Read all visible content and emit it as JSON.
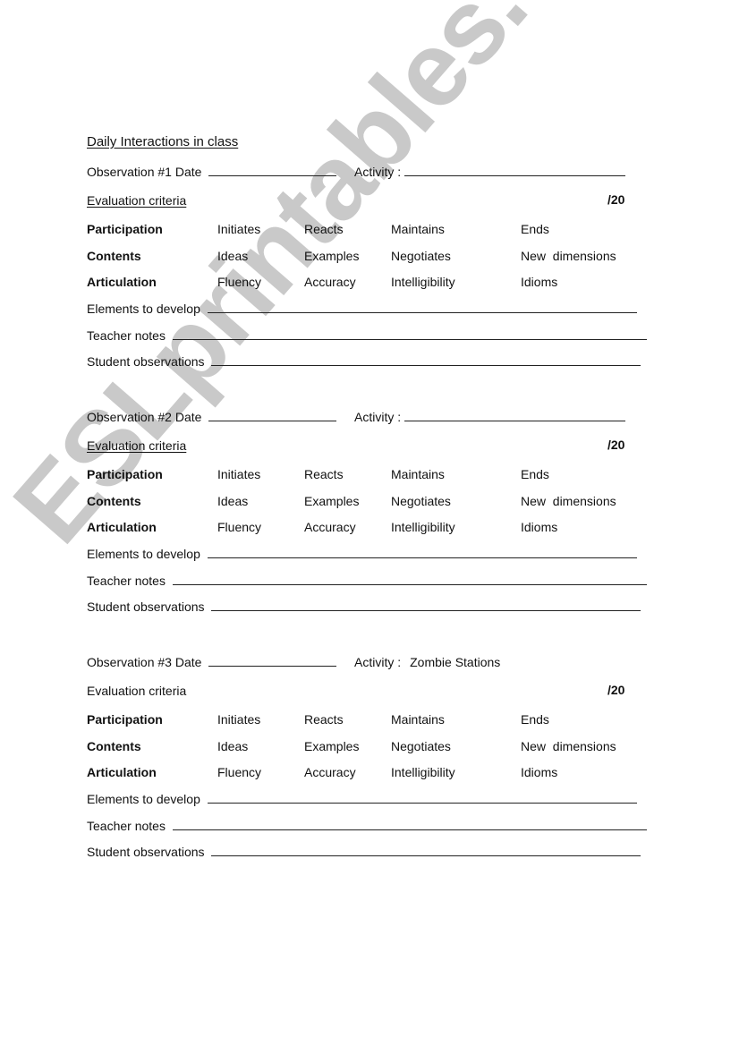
{
  "title": "Daily Interactions in class",
  "watermark": "ESLprintables.com",
  "observations": [
    {
      "label": "Observation #1 Date",
      "activity_label": "Activity :",
      "activity_value": "",
      "criteria_label": "Evaluation criteria",
      "criteria_underlined": true,
      "score": "/20",
      "criteria": [
        {
          "category": "Participation",
          "items": [
            "Initiates",
            "Reacts",
            "Maintains",
            "Ends"
          ]
        },
        {
          "category": "Contents",
          "items": [
            "Ideas",
            "Examples",
            "Negotiates",
            "New  dimensions"
          ]
        },
        {
          "category": "Articulation",
          "items": [
            "Fluency",
            "Accuracy",
            "Intelligibility",
            "Idioms"
          ]
        }
      ],
      "fields": [
        "Elements to develop",
        "Teacher notes",
        "Student observations"
      ]
    },
    {
      "label": "Observation #2 Date",
      "activity_label": "Activity :",
      "activity_value": "",
      "criteria_label": "Evaluation criteria",
      "criteria_underlined": true,
      "score": "/20",
      "criteria": [
        {
          "category": "Participation",
          "items": [
            "Initiates",
            "Reacts",
            "Maintains",
            "Ends"
          ]
        },
        {
          "category": "Contents",
          "items": [
            "Ideas",
            "Examples",
            "Negotiates",
            "New  dimensions"
          ]
        },
        {
          "category": "Articulation",
          "items": [
            "Fluency",
            "Accuracy",
            "Intelligibility",
            "Idioms"
          ]
        }
      ],
      "fields": [
        "Elements to develop",
        "Teacher notes",
        "Student observations"
      ]
    },
    {
      "label": "Observation #3 Date",
      "activity_label": "Activity :",
      "activity_value": "Zombie Stations",
      "criteria_label": "Evaluation criteria",
      "criteria_underlined": false,
      "score": "/20",
      "criteria": [
        {
          "category": "Participation",
          "items": [
            "Initiates",
            "Reacts",
            "Maintains",
            "Ends"
          ]
        },
        {
          "category": "Contents",
          "items": [
            "Ideas",
            "Examples",
            "Negotiates",
            "New  dimensions"
          ]
        },
        {
          "category": "Articulation",
          "items": [
            "Fluency",
            "Accuracy",
            "Intelligibility",
            "Idioms"
          ]
        }
      ],
      "fields": [
        "Elements to develop",
        "Teacher notes",
        "Student observations"
      ]
    }
  ]
}
